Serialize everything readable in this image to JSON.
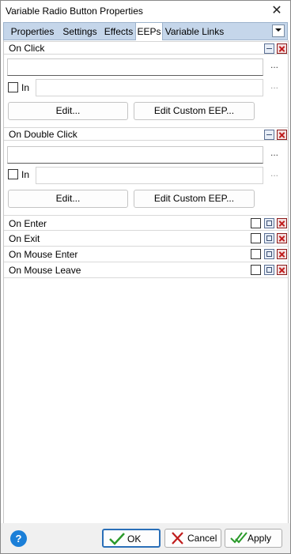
{
  "window": {
    "title": "Variable Radio Button Properties"
  },
  "tabs": [
    {
      "label": "Properties"
    },
    {
      "label": "Settings"
    },
    {
      "label": "Effects"
    },
    {
      "label": "EEPs",
      "active": true
    },
    {
      "label": "Variable Links"
    }
  ],
  "sections": {
    "on_click": {
      "label": "On Click",
      "field_value": "",
      "in_label": "In",
      "in_value": "",
      "edit_label": "Edit...",
      "custom_label": "Edit Custom EEP...",
      "more": "..."
    },
    "on_double_click": {
      "label": "On Double Click",
      "field_value": "",
      "in_label": "In",
      "in_value": "",
      "edit_label": "Edit...",
      "custom_label": "Edit Custom EEP...",
      "more": "..."
    }
  },
  "events": [
    {
      "label": "On Enter"
    },
    {
      "label": "On Exit"
    },
    {
      "label": "On Mouse Enter"
    },
    {
      "label": "On Mouse Leave"
    }
  ],
  "footer": {
    "help": "?",
    "ok_label": "OK",
    "cancel_label": "Cancel",
    "apply_label": "Apply"
  },
  "colors": {
    "tab_bar": "#c5d6ea",
    "accent": "#2a6fb8",
    "delete": "#c01c1c",
    "ok_check": "#2a9a2a"
  }
}
